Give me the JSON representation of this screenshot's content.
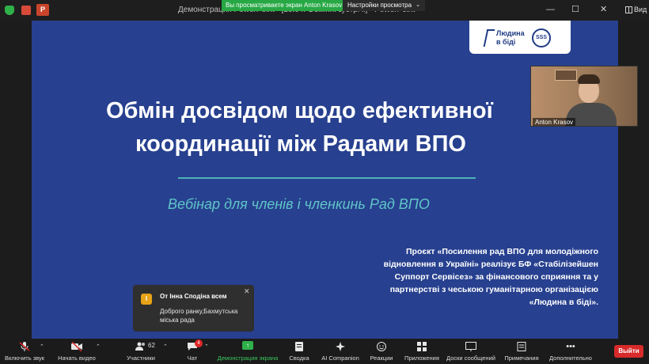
{
  "window": {
    "title": "Демонстрация PowerPoint - [20.04. Обмінні зустрічі] - PowerPoint",
    "ppt_badge": "P"
  },
  "share_banner": {
    "text": "Вы просматриваете экран Anton Krasov",
    "view_options": "Настройки просмотра",
    "view_options_caret": "⌄"
  },
  "window_controls": {
    "minimize": "—",
    "maximize": "☐",
    "close": "✕",
    "view_label": "Вид"
  },
  "slide": {
    "logo_line1": "Людина",
    "logo_line2": "в біді",
    "logo_sss": "SSS",
    "title_line1": "Обмін досвідом щодо ефективної",
    "title_line2": "координації між Радами ВПО",
    "subtitle": "Вебінар для членів і членкинь Рад ВПО",
    "project_text": "Проєкт «Посилення рад ВПО для молодіжного відновлення в Україні» реалізує БФ «Стабілізейшен Суппорт Сервісез» за фінансового сприяння та у партнерстві з чеською гуманітарною організацією «Людина в біді»."
  },
  "participant": {
    "name": "Anton Krasov"
  },
  "chat_popup": {
    "avatar_letter": "І",
    "from": "От Інна Сподіна всем",
    "message": "Доброго ранку,Бахмутська міська рада",
    "close": "✕"
  },
  "toolbar": {
    "unmute": "Включить звук",
    "start_video": "Начать видео",
    "participants": "Участники",
    "participants_count": "62",
    "chat": "Чат",
    "chat_badge": "4",
    "share_screen": "Демонстрация экрана",
    "whiteboards": "Сводка",
    "ai_companion": "AI Companion",
    "reactions": "Реакции",
    "apps": "Приложения",
    "whiteboard": "Доски сообщений",
    "notes": "Примечания",
    "more": "Дополнительно",
    "leave": "Выйти",
    "caret": "⌃"
  },
  "colors": {
    "slide_bg": "#27408f",
    "accent_teal": "#5fc5c8",
    "share_green": "#27a844",
    "leave_red": "#d72a2a"
  }
}
